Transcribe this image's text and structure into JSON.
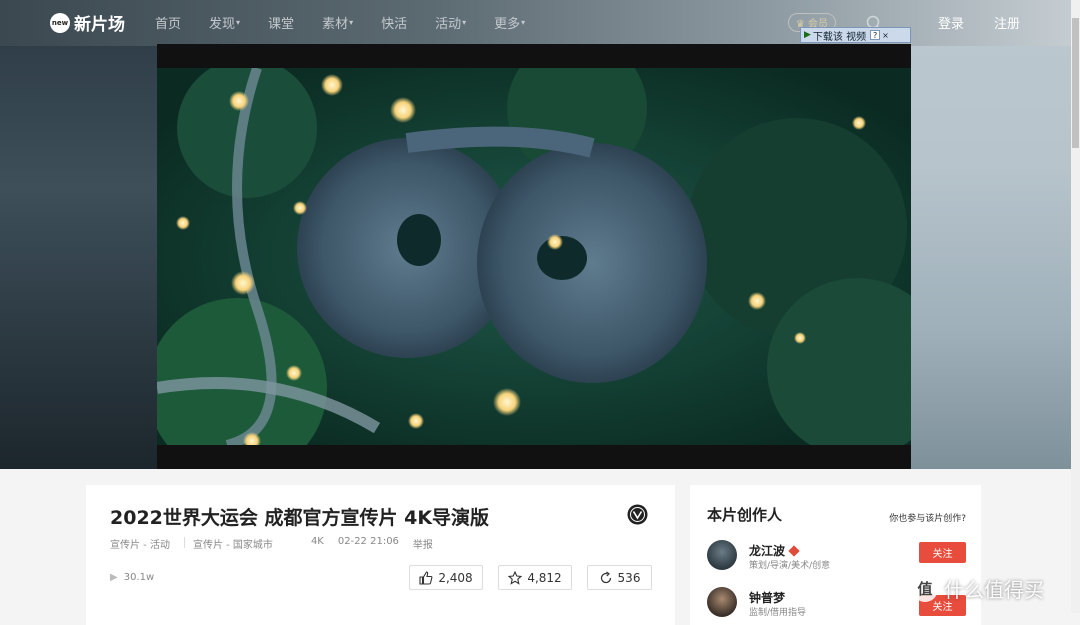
{
  "nav": {
    "logo_badge": "new",
    "logo_text": "新片场",
    "links": [
      "首页",
      "发现",
      "课堂",
      "素材",
      "快活",
      "活动",
      "更多"
    ],
    "vip_label": "会员",
    "login": "登录",
    "register": "注册"
  },
  "download_bar": {
    "label": "下载该 视频",
    "help": "?",
    "close": "×"
  },
  "video": {
    "title": "2022世界大运会 成都官方宣传片 4K导演版",
    "meta": {
      "category1": "宣传片 - 活动",
      "category2": "宣传片 - 国家城市",
      "quality": "4K",
      "date": "02-22 21:06",
      "report": "举报"
    },
    "views": "30.1w",
    "likes": "2,408",
    "favorites": "4,812",
    "shares": "536"
  },
  "creators": {
    "title": "本片创作人",
    "participate_link": "你也参与该片创作?",
    "follow_label": "关注",
    "list": [
      {
        "name": "龙江波",
        "role": "策划/导演/美术/创意"
      },
      {
        "name": "钟普梦",
        "role": "监制/借用指导"
      }
    ]
  },
  "watermark": {
    "symbol": "值",
    "text": "什么值得买"
  },
  "colors": {
    "accent": "#e74c3c",
    "bg": "#f4f4f4"
  }
}
